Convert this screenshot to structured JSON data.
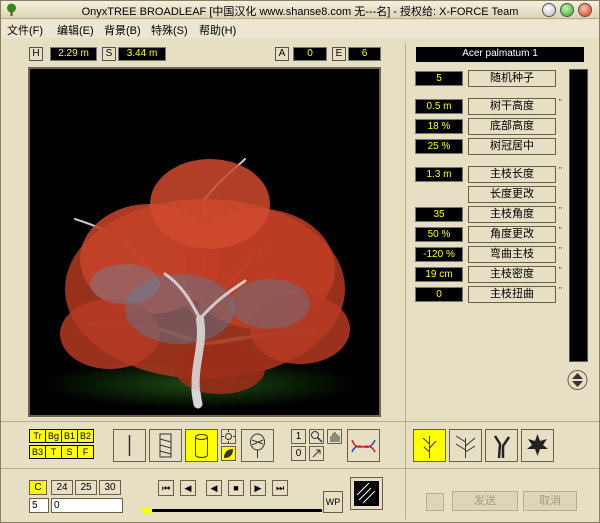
{
  "window": {
    "title": "OnyxTREE BROADLEAF [中国汉化 www.shanse8.com 无---名] - 授权给: X-FORCE Team"
  },
  "menu": [
    "文件(F)",
    "编辑(E)",
    "背景(B)",
    "特殊(S)",
    "帮助(H)"
  ],
  "topbar": {
    "h_label": "H",
    "h_value": "2.29 m",
    "s_label": "S",
    "s_value": "3.44 m",
    "a_label": "A",
    "a_value": "0",
    "e_label": "E",
    "e_value": "6"
  },
  "species": "Acer palmatum 1",
  "params": [
    {
      "value": "5",
      "label": "随机种子",
      "has_mark": false
    },
    {
      "value": "0.5 m",
      "label": "树干高度",
      "has_mark": true
    },
    {
      "value": "18 %",
      "label": "底部高度",
      "has_mark": false
    },
    {
      "value": "25 %",
      "label": "树冠居中",
      "has_mark": false
    },
    {
      "value": "1.3 m",
      "label": "主枝长度",
      "has_mark": true
    },
    {
      "value": "",
      "label": "长度更改",
      "has_mark": false
    },
    {
      "value": "35",
      "label": "主枝角度",
      "has_mark": true
    },
    {
      "value": "50 %",
      "label": "角度更改",
      "has_mark": true
    },
    {
      "value": "-120 %",
      "label": "弯曲主枝",
      "has_mark": true
    },
    {
      "value": "19 cm",
      "label": "主枝密度",
      "has_mark": true
    },
    {
      "value": "0",
      "label": "主枝扭曲",
      "has_mark": true
    }
  ],
  "toggles": [
    "Tr",
    "Bg",
    "B1",
    "B2",
    "B3",
    "T",
    "S",
    "F"
  ],
  "counters": [
    "1",
    "0"
  ],
  "frames": {
    "items": [
      "C",
      "24",
      "25",
      "30"
    ],
    "field_a": "5",
    "field_b": "0"
  },
  "wp_label": "WP",
  "actions": {
    "send": "发送",
    "cancel": "取消"
  },
  "colors": {
    "accent": "#ffff00",
    "panel": "#e7dfc4",
    "viewport": "#000000"
  }
}
